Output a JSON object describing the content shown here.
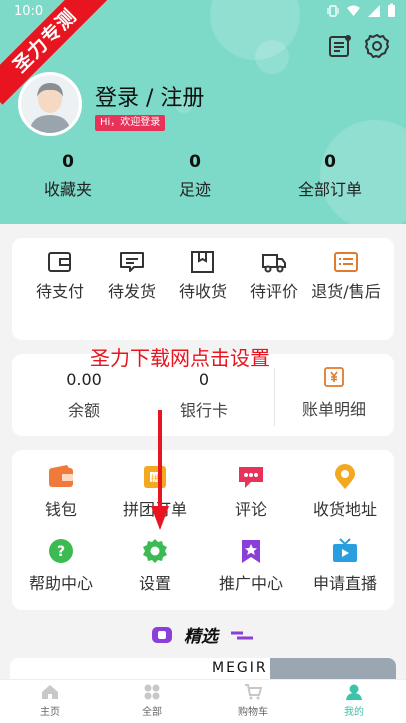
{
  "status_bar": {
    "time": "10:0"
  },
  "ribbon": {
    "text": "圣力专测"
  },
  "profile": {
    "login_title": "登录 / 注册",
    "welcome": "Hi，欢迎登录"
  },
  "stats": [
    {
      "value": "0",
      "label": "收藏夹"
    },
    {
      "value": "0",
      "label": "足迹"
    },
    {
      "value": "0",
      "label": "全部订单"
    }
  ],
  "orders": [
    {
      "label": "待支付",
      "icon": "wallet-icon"
    },
    {
      "label": "待发货",
      "icon": "message-box-icon"
    },
    {
      "label": "待收货",
      "icon": "package-icon"
    },
    {
      "label": "待评价",
      "icon": "truck-icon"
    },
    {
      "label": "退货/售后",
      "icon": "return-list-icon"
    }
  ],
  "wallet": {
    "balance_value": "0.00",
    "balance_label": "余额",
    "bankcard_value": "0",
    "bankcard_label": "银行卡",
    "bill_label": "账单明细"
  },
  "overlay": {
    "text": "圣力下载网点击设置"
  },
  "services": [
    {
      "label": "钱包",
      "icon": "wallet-icon",
      "color": "#f07a3c"
    },
    {
      "label": "拼团订单",
      "icon": "group-order-icon",
      "color": "#f3a91f"
    },
    {
      "label": "评论",
      "icon": "comment-icon",
      "color": "#e8325a"
    },
    {
      "label": "收货地址",
      "icon": "location-icon",
      "color": "#f3a91f"
    },
    {
      "label": "帮助中心",
      "icon": "help-icon",
      "color": "#3dbb53"
    },
    {
      "label": "设置",
      "icon": "gear-icon",
      "color": "#3dbb53"
    },
    {
      "label": "推广中心",
      "icon": "star-bookmark-icon",
      "color": "#8b3fd9"
    },
    {
      "label": "申请直播",
      "icon": "tv-icon",
      "color": "#2a9fe0"
    }
  ],
  "featured": {
    "title": "精选"
  },
  "promo": {
    "text": "MEGIR"
  },
  "tabbar": [
    {
      "label": "主页",
      "icon": "home-icon"
    },
    {
      "label": "全部",
      "icon": "grid-icon"
    },
    {
      "label": "购物车",
      "icon": "cart-icon"
    },
    {
      "label": "我的",
      "icon": "user-icon"
    }
  ],
  "colors": {
    "header": "#7dd9c8",
    "accent": "#3cc3a8",
    "ribbon": "#e8141f",
    "badge": "#e8325a"
  }
}
